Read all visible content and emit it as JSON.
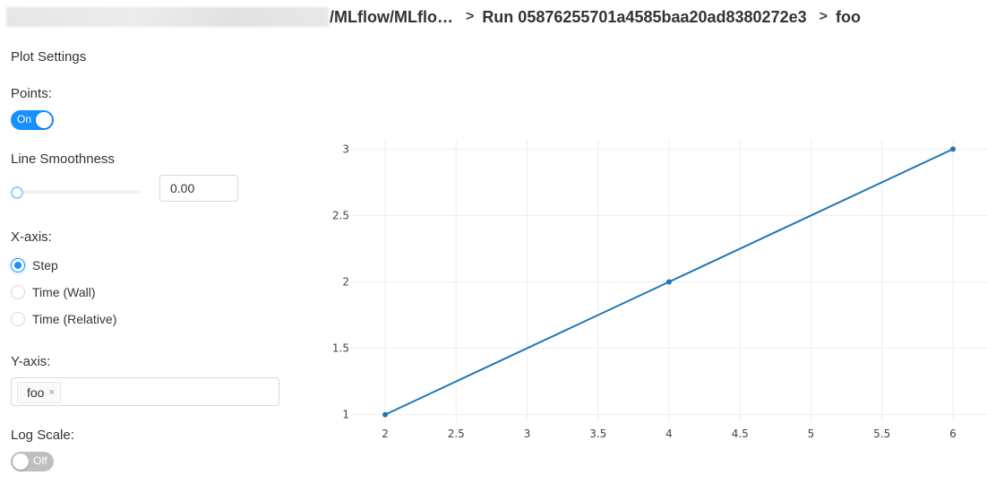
{
  "breadcrumb": {
    "items": [
      "/MLflow/MLflo…",
      "Run 05876255701a4585baa20ad8380272e3",
      "foo"
    ],
    "separator": ">"
  },
  "settings": {
    "title": "Plot Settings",
    "points": {
      "label": "Points:",
      "state": "On"
    },
    "smoothness": {
      "label": "Line Smoothness",
      "value": "0.00",
      "slider_fraction": 0.0
    },
    "xaxis": {
      "label": "X-axis:",
      "options": [
        "Step",
        "Time (Wall)",
        "Time (Relative)"
      ],
      "selected": "Step"
    },
    "yaxis": {
      "label": "Y-axis:",
      "tags": [
        "foo"
      ],
      "close_glyph": "×"
    },
    "log_scale": {
      "label": "Log Scale:",
      "state": "Off"
    }
  },
  "colors": {
    "accent": "#1890ff",
    "line": "#1f77b4",
    "grid": "#eeeeee"
  },
  "chart_data": {
    "type": "line",
    "title": "",
    "xlabel": "",
    "ylabel": "",
    "series": [
      {
        "name": "foo",
        "x": [
          2,
          4,
          6
        ],
        "y": [
          1,
          2,
          3
        ],
        "markers": true
      }
    ],
    "xlim": [
      1.76,
      6.24
    ],
    "ylim": [
      0.95,
      3.07
    ],
    "xticks": [
      2,
      2.5,
      3,
      3.5,
      4,
      4.5,
      5,
      5.5,
      6
    ],
    "xtick_labels": [
      "2",
      "2.5",
      "3",
      "3.5",
      "4",
      "4.5",
      "5",
      "5.5",
      "6"
    ],
    "yticks": [
      1,
      1.5,
      2,
      2.5,
      3
    ],
    "ytick_labels": [
      "1",
      "1.5",
      "2",
      "2.5",
      "3"
    ],
    "grid": true,
    "legend": "none"
  }
}
